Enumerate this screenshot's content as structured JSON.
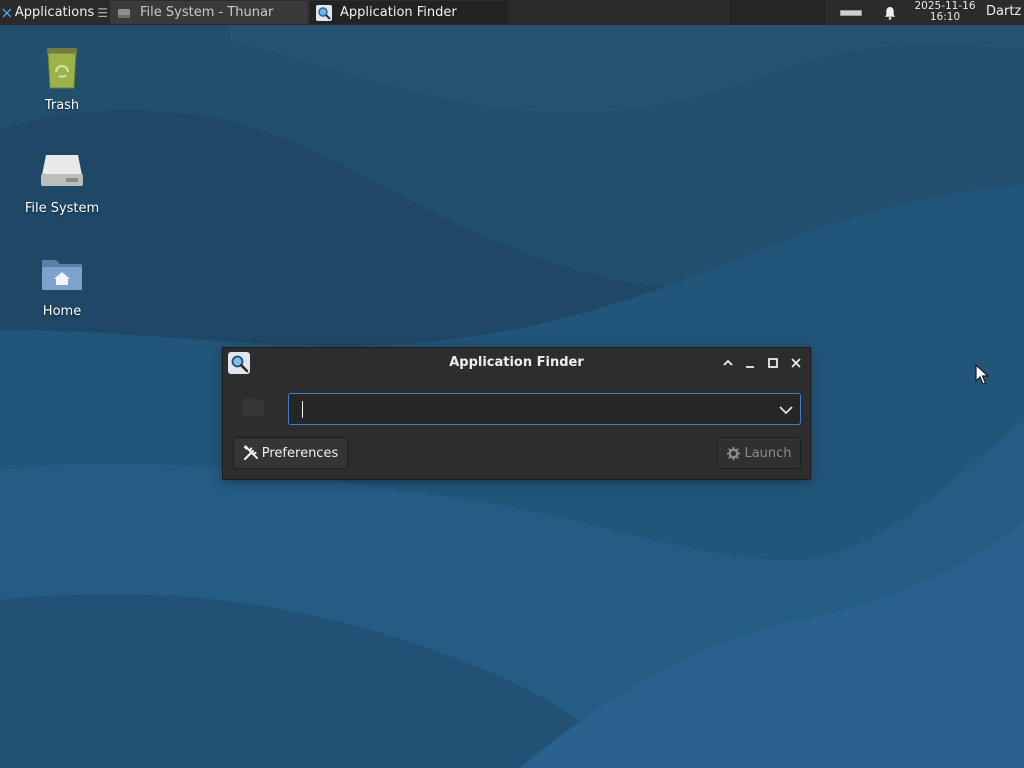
{
  "panel": {
    "applications_label": "Applications",
    "separator": "☰",
    "tasks": [
      {
        "label": "File System - Thunar",
        "icon": "drive-icon",
        "active": false
      },
      {
        "label": "Application Finder",
        "icon": "search-icon",
        "active": true
      }
    ],
    "clock": {
      "date": "2025-11-16",
      "time": "16:10"
    },
    "user": "Dartz"
  },
  "desktop": {
    "icons": [
      {
        "label": "Trash",
        "icon": "trash-icon"
      },
      {
        "label": "File System",
        "icon": "drive-icon"
      },
      {
        "label": "Home",
        "icon": "home-folder-icon"
      }
    ]
  },
  "window": {
    "title": "Application Finder",
    "search": {
      "value": "",
      "placeholder": ""
    },
    "preferences_label": "Preferences",
    "launch_label": "Launch",
    "launch_enabled": false
  },
  "colors": {
    "panel": "#2b2b2b",
    "wallpaper_base": "#1f4a68",
    "focus_accent": "#3d7fd6"
  }
}
